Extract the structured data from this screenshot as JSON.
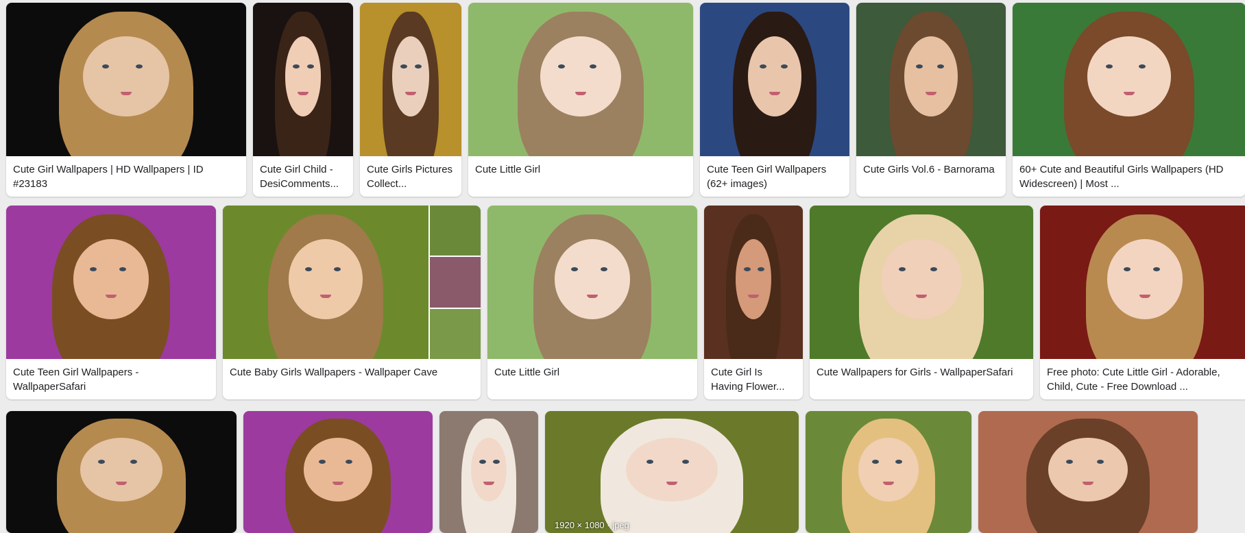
{
  "results": {
    "row1": [
      {
        "caption": "Cute Girl Wallpapers | HD Wallpapers | ID #23183",
        "width": 350,
        "bg": "#0c0c0c",
        "hair": "#b58a4f",
        "skin": "#e6c4a6"
      },
      {
        "caption": "Cute Girl Child - DesiComments...",
        "width": 146,
        "bg": "#1a1210",
        "hair": "#3a2418",
        "skin": "#f0cdb5"
      },
      {
        "caption": "Cute Girls Pictures Collect...",
        "width": 148,
        "bg": "#b8902c",
        "hair": "#5a3a22",
        "skin": "#ead0bc"
      },
      {
        "caption": "Cute Little Girl",
        "width": 328,
        "bg": "#8fb96a",
        "hair": "#9b8160",
        "skin": "#f3dccb"
      },
      {
        "caption": "Cute Teen Girl Wallpapers (62+ images)",
        "width": 218,
        "bg": "#2c4880",
        "hair": "#2a1a14",
        "skin": "#e9c6ab"
      },
      {
        "caption": "Cute Girls Vol.6 - Barnorama",
        "width": 218,
        "bg": "#3d5a3a",
        "hair": "#6b4a30",
        "skin": "#e6c0a0"
      },
      {
        "caption": "60+ Cute and Beautiful Girls Wallpapers (HD Widescreen) | Most ...",
        "width": 340,
        "bg": "#3a7a38",
        "hair": "#7a4a2a",
        "skin": "#f2d6c2"
      }
    ],
    "row2": [
      {
        "caption": "Cute Teen Girl Wallpapers - WallpaperSafari",
        "width": 306,
        "bg": "#9c3aa0",
        "hair": "#7a4e22",
        "skin": "#e9b996"
      },
      {
        "caption": "Cute Baby Girls Wallpapers - Wallpaper Cave",
        "width": 376,
        "bg": "#6c8a2c",
        "hair": "#a07a4a",
        "skin": "#eecaa8"
      },
      {
        "caption": "Cute Little Girl",
        "width": 306,
        "bg": "#8fb96a",
        "hair": "#9b8160",
        "skin": "#f3dccb"
      },
      {
        "caption": "Cute Girl Is Having Flower...",
        "width": 144,
        "bg": "#5a3020",
        "hair": "#4a2a18",
        "skin": "#d49a7a"
      },
      {
        "caption": "Cute Wallpapers for Girls - WallpaperSafari",
        "width": 326,
        "bg": "#4e7a2a",
        "hair": "#e8d2a8",
        "skin": "#f0d0b8"
      },
      {
        "caption": "Free photo: Cute Little Girl - Adorable, Child, Cute - Free Download ...",
        "width": 306,
        "bg": "#7a1a14",
        "hair": "#b88a50",
        "skin": "#f2d4c0"
      }
    ],
    "row3": [
      {
        "width": 336,
        "bg": "#0c0c0c",
        "hair": "#b58a4f",
        "skin": "#e6c4a6"
      },
      {
        "width": 276,
        "bg": "#9c3aa0",
        "hair": "#7a4e22",
        "skin": "#e9b996"
      },
      {
        "width": 144,
        "bg": "#8c7a70",
        "hair": "#f0e8de",
        "skin": "#f2d8c8"
      },
      {
        "width": 370,
        "bg": "#6a7a2a",
        "hair": "#f0e8de",
        "skin": "#f2d8c8",
        "badge": "1920 × 1080 · jpeg"
      },
      {
        "width": 242,
        "bg": "#6a8a3a",
        "hair": "#e4c080",
        "skin": "#f0cfb2"
      },
      {
        "width": 320,
        "bg": "#b06a50",
        "hair": "#6a4028",
        "skin": "#ecc8ae"
      }
    ]
  }
}
